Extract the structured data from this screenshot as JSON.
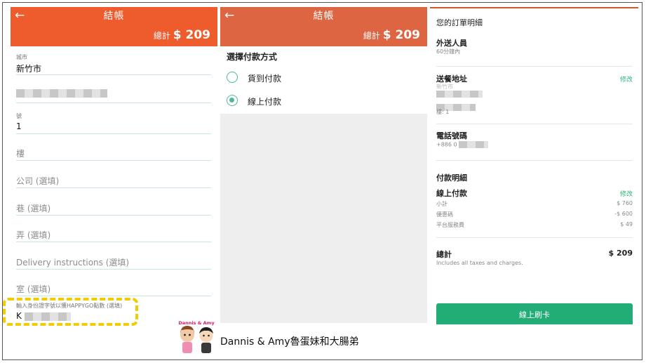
{
  "header": {
    "back_icon": "←",
    "title": "結帳",
    "total_label": "總計",
    "total_amount": "$ 209"
  },
  "address_form": {
    "city_label": "城市",
    "city_value": "新竹市",
    "number_label": "號",
    "number_value": "1",
    "floor_placeholder": "樓",
    "company_placeholder": "公司 (選填)",
    "lane_placeholder": "巷 (選填)",
    "alley_placeholder": "弄 (選填)",
    "instructions_placeholder": "Delivery instructions (選填)",
    "room_placeholder": "室 (選填)",
    "happygo_label": "輸入身份證字號以獲HAPPYGO點數 (選填)",
    "happygo_value_prefix": "K"
  },
  "payment": {
    "section_title": "選擇付款方式",
    "options": [
      {
        "label": "貨到付款",
        "selected": false
      },
      {
        "label": "線上付款",
        "selected": true
      }
    ]
  },
  "order_summary": {
    "title": "您的訂單明細",
    "delivery_label": "外送人員",
    "delivery_time": "60分鐘內",
    "address_label": "送餐地址",
    "address_edit": "修改",
    "address_city_partial": "新竹市",
    "address_floor": "樓: 1",
    "phone_label": "電話號碼",
    "phone_value": "+886 0",
    "payment_details_title": "付款明細",
    "payment_method": "線上付款",
    "payment_edit": "修改",
    "subtotal_label": "小計",
    "subtotal_value": "$ 760",
    "coupon_label": "優惠碼",
    "coupon_value": "-$ 600",
    "fee_label": "平台服務費",
    "fee_value": "$ 49",
    "total_label": "總計",
    "total_value": "$ 209",
    "tax_note": "Includes all taxes and charges.",
    "pay_button": "線上刷卡"
  },
  "watermark": {
    "art_label": "Dannis & Amy",
    "text": "Dannis & Amy魯蛋妹和大腸弟"
  },
  "colors": {
    "header_orange": "#ee5b2d",
    "header_orange_alt": "#dd6542",
    "accent_green": "#2eb27a",
    "button_green": "#23ad76",
    "highlight_yellow": "#f2cc00"
  }
}
